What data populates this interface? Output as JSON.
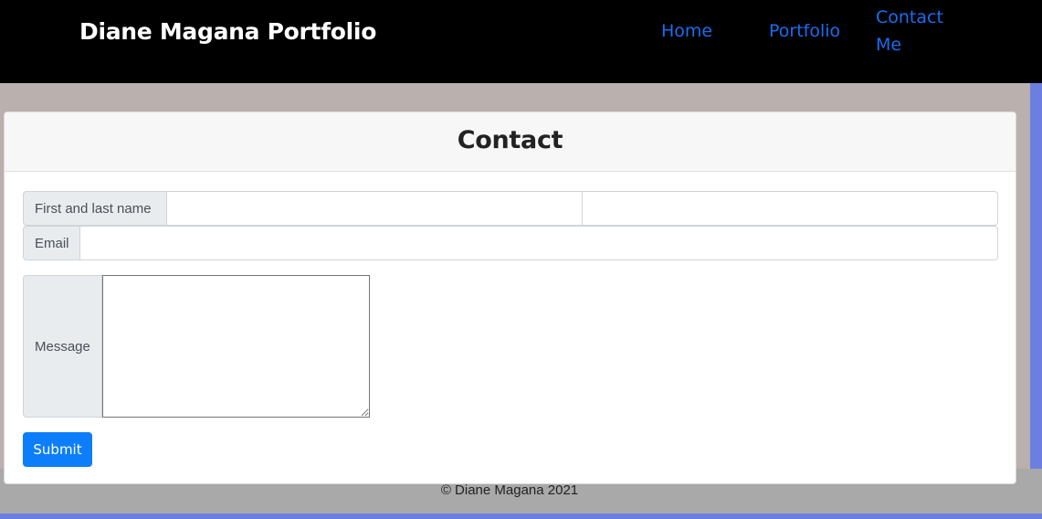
{
  "nav": {
    "brand": "Diane Magana Portfolio",
    "links": [
      {
        "label": "Home"
      },
      {
        "label": "Portfolio"
      },
      {
        "label": "Contact Me"
      }
    ]
  },
  "card": {
    "title": "Contact",
    "fields": {
      "name_label": "First and last name",
      "first_name_value": "",
      "last_name_value": "",
      "email_label": "Email",
      "email_value": "",
      "message_label": "Message",
      "message_value": ""
    },
    "submit_label": "Submit"
  },
  "footer": {
    "text": "© Diane Magana 2021"
  },
  "colors": {
    "nav_bg": "#000000",
    "page_bg": "#bab0ad",
    "link": "#1a6cf0",
    "accent_bar": "#6c7fe0",
    "footer_bg": "#a9a9a9",
    "submit_bg": "#0d7ef9"
  }
}
